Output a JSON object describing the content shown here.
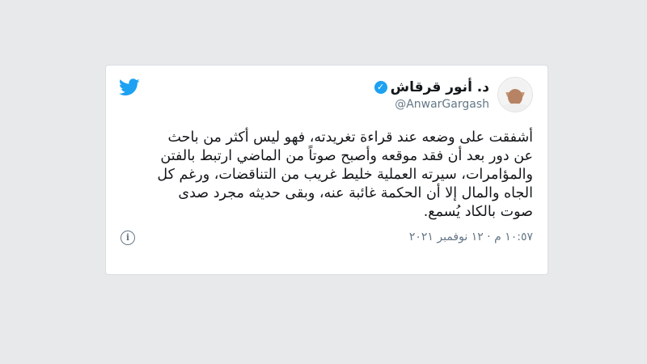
{
  "tweet": {
    "author_name": "د. أنور قرقاش",
    "handle": "@AnwarGargash",
    "verified_mark": "✓",
    "text": "أشفقت على وضعه عند قراءة تغريدته، فهو ليس أكثر من باحث\nعن دور بعد أن فقد موقعه وأصبح صوتاً من الماضي ارتبط بالفتن\nوالمؤامرات، سيرته العملية خليط غريب من التناقضات، ورغم كل\nالجاه والمال إلا أن الحكمة غائبة عنه، وبقى حديثه مجرد صدى\nصوت بالكاد يُسمع.",
    "timestamp": "١٠:٥٧ م · ١٢ نوفمبر ٢٠٢١",
    "info_glyph": "i"
  },
  "icons": {
    "brand": "twitter-bird-icon",
    "info": "info-icon",
    "verified": "verified-badge-icon"
  },
  "colors": {
    "brand_blue": "#1da1f2",
    "text": "#14171a",
    "secondary": "#657786"
  }
}
